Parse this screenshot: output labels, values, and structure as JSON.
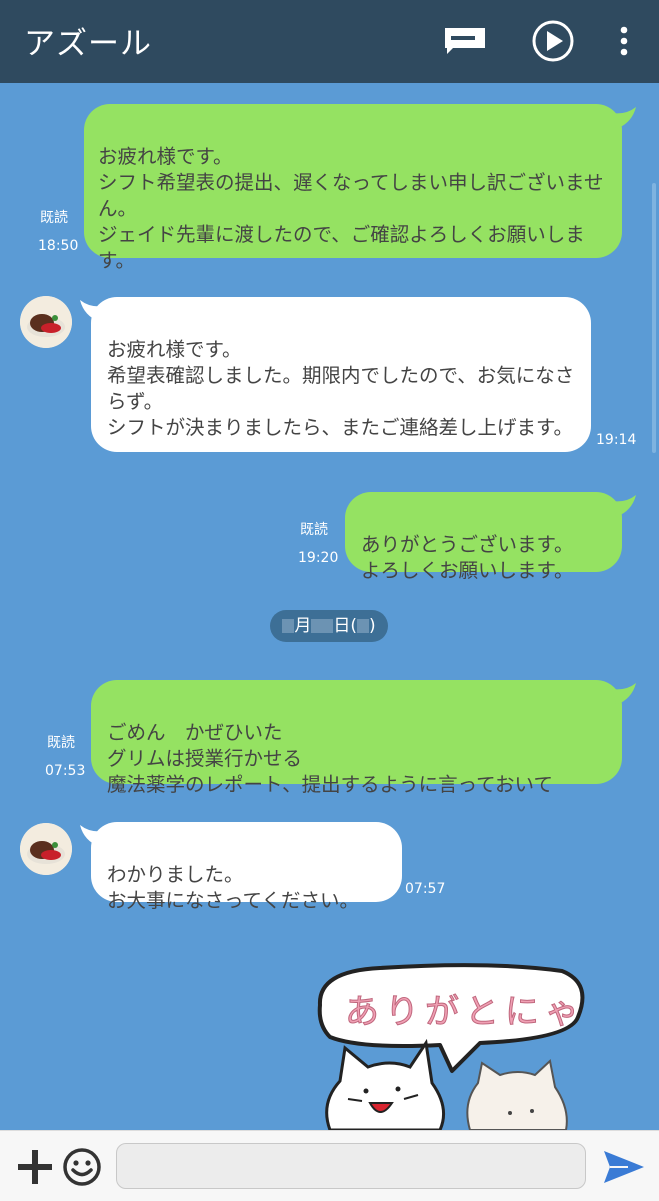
{
  "header": {
    "title": "アズール",
    "icons": [
      "chat-notes-icon",
      "play-circle-icon",
      "more-vert-icon"
    ]
  },
  "messages": [
    {
      "side": "me",
      "text": "お疲れ様です。\nシフト希望表の提出、遅くなってしまい申し訳ございません。\nジェイド先輩に渡したので、ご確認よろしくお願いします。",
      "read": "既読",
      "time": "18:50"
    },
    {
      "side": "other",
      "text": "お疲れ様です。\n希望表確認しました。期限内でしたので、お気になさらず。\nシフトが決まりましたら、またご連絡差し上げます。",
      "time": "19:14"
    },
    {
      "side": "me",
      "text": "ありがとうございます。\nよろしくお願いします。",
      "read": "既読",
      "time": "19:20"
    },
    {
      "side": "other-date",
      "text": "月 日( )"
    },
    {
      "side": "other",
      "text": "ごめん　かぜひいた\nグリムは授業行かせる\n魔法薬学のレポート、提出するように言っておいて",
      "read": "既読",
      "time": "07:53"
    },
    {
      "side": "me",
      "text": "わかりました。\nお大事になさってください。",
      "time": "07:57"
    }
  ],
  "date_divider": {
    "month_label": "月",
    "day_label": "日(",
    "close": ")"
  },
  "sticker": {
    "text": "ありがとにゃ"
  },
  "bottom_bar": {
    "input_placeholder": "",
    "icons": [
      "plus-icon",
      "emoji-icon",
      "send-icon"
    ]
  },
  "colors": {
    "header": "#2f4a5f",
    "background": "#5b9bd5",
    "my_bubble": "#95e262",
    "other_bubble": "#ffffff",
    "send": "#3a7bd5"
  }
}
